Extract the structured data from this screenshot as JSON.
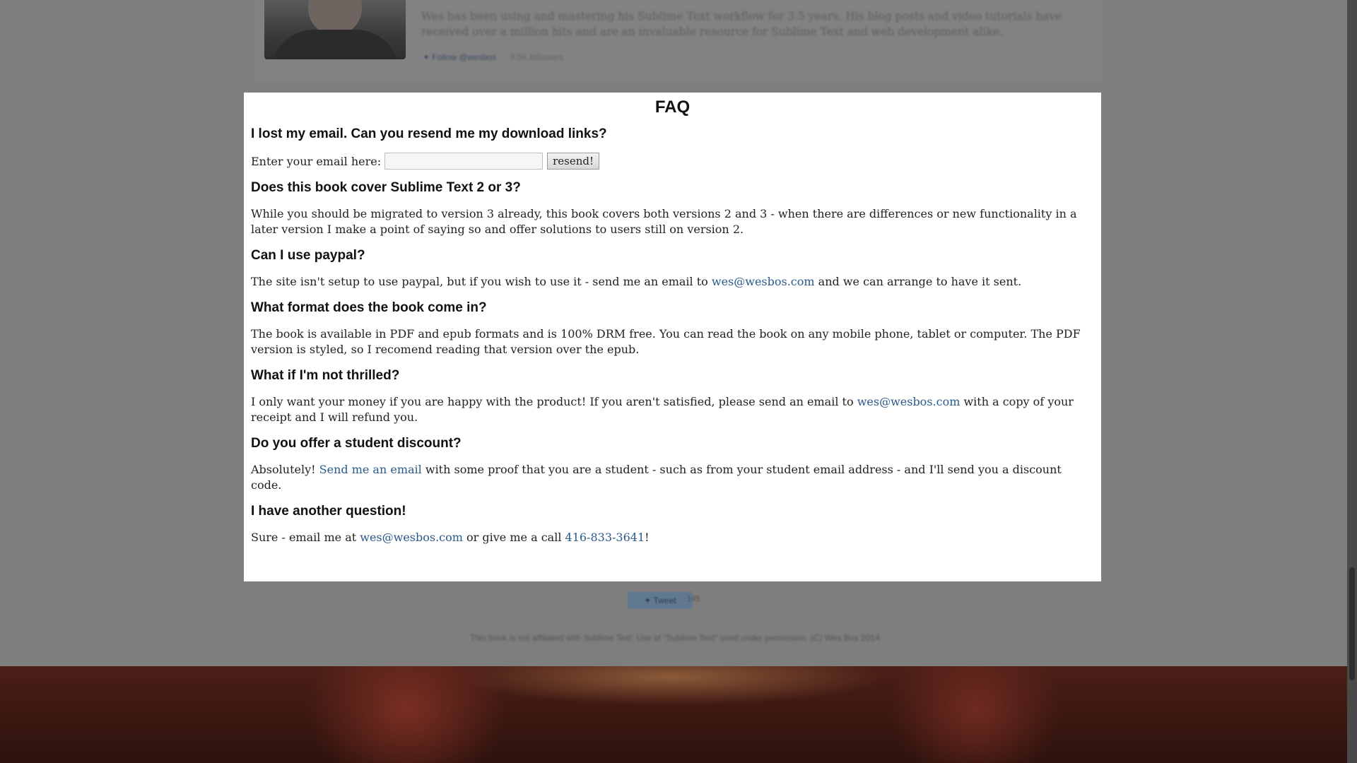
{
  "background": {
    "author_bio": "Wes has been using and mastering his Sublime Text workflow for 3.5 years. His blog posts and video tutorials have received over a million hits and are an invaluable resource for Sublime Text and web development alike.",
    "follow_label": "Follow @wesbos",
    "follower_count": "9.5K followers",
    "tweet_label": "Tweet",
    "tweet_count": "145",
    "footer_text": "This book is not affiliated with Sublime Text. Use of \"Sublime Text\" used under permission. (C) Wes Bos 2014"
  },
  "faq": {
    "title": "FAQ",
    "items": [
      {
        "question": "I lost my email. Can you resend me my download links?"
      },
      {
        "question": "Does this book cover Sublime Text 2 or 3?",
        "answer": "While you should be migrated to version 3 already, this book covers both versions 2 and 3 - when there are differences or new functionality in a later version I make a point of saying so and offer solutions to users still on version 2."
      },
      {
        "question": "Can I use paypal?",
        "answer_pre": "The site isn't setup to use paypal, but if you wish to use it - send me an email to ",
        "answer_link": "wes@wesbos.com",
        "answer_post": " and we can arrange to have it sent."
      },
      {
        "question": "What format does the book come in?",
        "answer": "The book is available in PDF and epub formats and is 100% DRM free. You can read the book on any mobile phone, tablet or computer. The PDF version is styled, so I recomend reading that version over the epub."
      },
      {
        "question": "What if I'm not thrilled?",
        "answer_pre": "I only want your money if you are happy with the product! If you aren't satisfied, please send an email to ",
        "answer_link": "wes@wesbos.com",
        "answer_post": " with a copy of your receipt and I will refund you."
      },
      {
        "question": "Do you offer a student discount?",
        "answer_pre": "Absolutely! ",
        "answer_link": "Send me an email",
        "answer_post": " with some proof that you are a student - such as from your student email address - and I'll send you a discount code."
      },
      {
        "question": "I have another question!",
        "answer_pre": "Sure - email me at ",
        "answer_link": "wes@wesbos.com",
        "answer_mid": " or give me a call ",
        "answer_link2": "416-833-3641",
        "answer_post": "!"
      }
    ],
    "email_form": {
      "label": "Enter your email here:",
      "input_value": "",
      "button_label": "resend!"
    }
  }
}
